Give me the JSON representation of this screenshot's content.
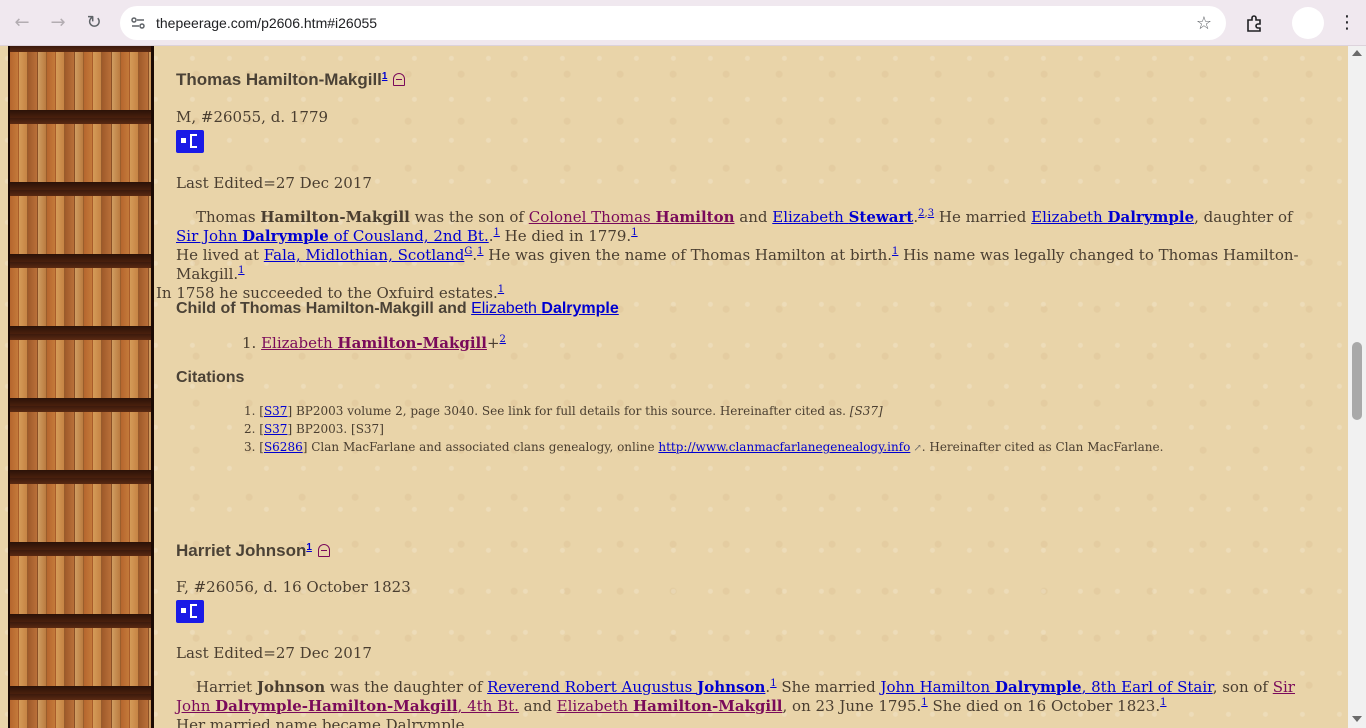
{
  "browser": {
    "url": "thepeerage.com/p2606.htm#i26055"
  },
  "person1": {
    "name": "Thomas Hamilton-Makgill",
    "name_sup": "1",
    "meta": "M, #26055, d. 1779",
    "last_edited": "Last Edited=27 Dec 2017",
    "para": {
      "t1": "Thomas ",
      "b1": "Hamilton-Makgill",
      "t2": " was the son of ",
      "father_first": "Colonel Thomas ",
      "father_last": "Hamilton",
      "t3": " and ",
      "mother_first": "Elizabeth ",
      "mother_last": "Stewart",
      "s1": "2",
      "s2": "3",
      "t4": " He married ",
      "spouse_first": "Elizabeth ",
      "spouse_last": "Dalrymple",
      "t5": ", daughter of ",
      "fil_first": "Sir John ",
      "fil_last": "Dalrymple",
      "fil_title": " of Cousland, 2nd Bt.",
      "t6": ".",
      "s3": "1",
      "t7": " He died in 1779.",
      "s4": "1",
      "t8": "He lived at ",
      "place": "Fala, Midlothian, Scotland",
      "place_sup": "G",
      "s5": "1",
      "t9": " He was given the name of Thomas Hamilton at birth.",
      "s6": "1",
      "t10": " His name was legally changed to Thomas Hamilton-Makgill.",
      "s7": "1",
      "t11": "In 1758 he succeeded to the Oxfuird estates.",
      "s8": "1"
    },
    "child_heading_prefix": "Child of Thomas Hamilton-Makgill and ",
    "child_heading_wife_first": "Elizabeth ",
    "child_heading_wife_last": "Dalrymple",
    "children": [
      {
        "num": "1.",
        "first": "Elizabeth ",
        "last": "Hamilton-Makgill",
        "plus": "+",
        "sup": "2"
      }
    ],
    "citations_heading": "Citations",
    "citations": [
      {
        "num": "1.",
        "src": "S37",
        "text": " BP2003 volume 2, page 3040. See link for full details for this source. Hereinafter cited as. ",
        "italic": "[S37]"
      },
      {
        "num": "2.",
        "src": "S37",
        "text": " BP2003. [S37]"
      },
      {
        "num": "3.",
        "src": "S6286",
        "text": " Clan MacFarlane and associated clans genealogy, online ",
        "link": "http://www.clanmacfarlanegenealogy.info",
        "after": ". Hereinafter cited as Clan MacFarlane."
      }
    ]
  },
  "person2": {
    "name": "Harriet Johnson",
    "name_sup": "1",
    "meta": "F, #26056, d. 16 October 1823",
    "last_edited": "Last Edited=27 Dec 2017",
    "para": {
      "t1": "Harriet ",
      "b1": "Johnson",
      "t2": " was the daughter of ",
      "father_first": "Reverend Robert Augustus ",
      "father_last": "Johnson",
      "s1": "1",
      "t3": " She married ",
      "spouse_first": "John Hamilton ",
      "spouse_last": "Dalrymple",
      "spouse_title": ", 8th Earl of Stair",
      "t4": ", son of ",
      "fil_first": "Sir John ",
      "fil_last": "Dalrymple-Hamilton-Makgill",
      "fil_title": ", 4th Bt.",
      "t5": " and ",
      "mil_first": "Elizabeth ",
      "mil_last": "Hamilton-Makgill",
      "t6": ", on 23 June 1795.",
      "s2": "1",
      "t7": " She died on 16 October 1823.",
      "s3": "1",
      "t8": "Her married name became Dalrymple."
    }
  }
}
